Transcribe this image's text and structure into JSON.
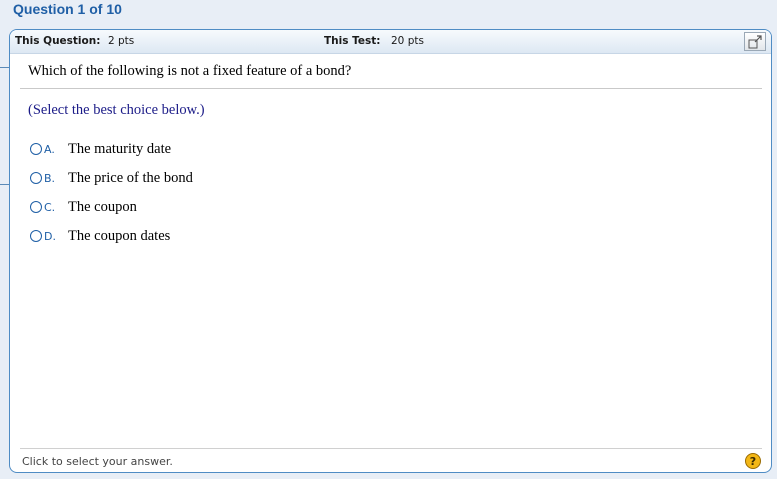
{
  "header": {
    "title": "Question 1 of 10"
  },
  "panel_top": {
    "question_label": "This Question:",
    "question_points": "2 pts",
    "test_label": "This Test:",
    "test_points": "20 pts"
  },
  "question": {
    "text": "Which of the following is not a fixed feature of a bond?",
    "instruction": "(Select the best choice below.)",
    "choices": [
      {
        "letter": "A.",
        "text": "The maturity date"
      },
      {
        "letter": "B.",
        "text": "The price of the bond"
      },
      {
        "letter": "C.",
        "text": "The coupon"
      },
      {
        "letter": "D.",
        "text": "The coupon dates"
      }
    ]
  },
  "footer": {
    "hint": "Click to select your answer.",
    "help_icon_glyph": "?"
  },
  "colors": {
    "accent": "#1f5fa6",
    "instruction": "#1c1c88",
    "help": "#f3b716"
  },
  "icons": [
    "expand-icon",
    "help-icon",
    "radio-icon"
  ]
}
